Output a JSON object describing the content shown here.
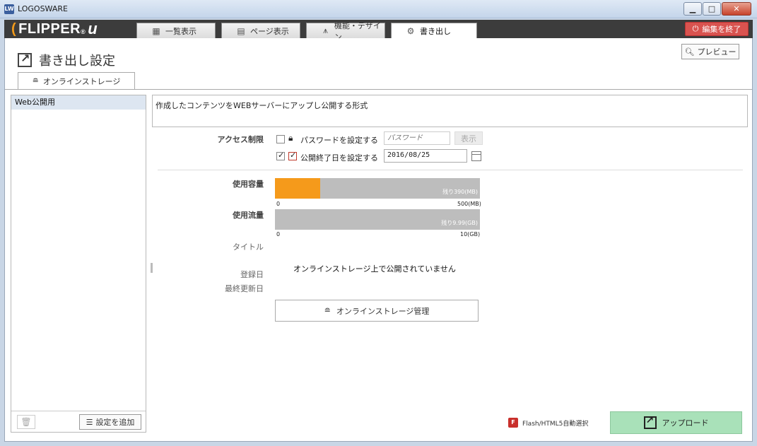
{
  "window": {
    "app_title": "LOGOSWARE",
    "app_icon_text": "LW"
  },
  "logo": {
    "brand": "FLIPPER",
    "reg": "®",
    "suffix": "u"
  },
  "tabs": [
    {
      "label": "一覧表示",
      "icon": "grid-icon"
    },
    {
      "label": "ページ表示",
      "icon": "page-icon"
    },
    {
      "label": "機能・デザイン",
      "icon": "design-icon"
    },
    {
      "label": "書き出し",
      "icon": "gear-icon",
      "active": true
    }
  ],
  "end_button": {
    "label": "編集を終了"
  },
  "page": {
    "title": "書き出し設定",
    "preview_label": "プレビュー"
  },
  "subtab": {
    "label": "オンラインストレージ"
  },
  "left": {
    "items": [
      {
        "label": "Web公開用",
        "selected": true
      }
    ],
    "add_label": "設定を追加"
  },
  "description": "作成したコンテンツをWEBサーバーにアップし公開する形式",
  "access": {
    "label": "アクセス制限",
    "password_label": "パスワードを設定する",
    "password_placeholder": "パスワード",
    "show_label": "表示",
    "password_checked": false,
    "expiry_label": "公開終了日を設定する",
    "expiry_checked": true,
    "expiry_date": "2016/08/25"
  },
  "usage": {
    "capacity_label": "使用容量",
    "capacity_remaining": "残り390(MB)",
    "capacity_min": "0",
    "capacity_max": "500(MB)",
    "capacity_used_fraction": 0.22,
    "traffic_label": "使用流量",
    "traffic_remaining": "残り9.99(GB)",
    "traffic_min": "0",
    "traffic_max": "10(GB)",
    "traffic_used_fraction": 0.0
  },
  "info": {
    "title_label": "タイトル",
    "registered_label": "登録日",
    "updated_label": "最終更新日",
    "not_published": "オンラインストレージ上で公開されていません"
  },
  "storage_manage_label": "オンラインストレージ管理",
  "flash_label": "Flash/HTML5自動選択",
  "upload_label": "アップロード",
  "colors": {
    "accent_orange": "#f59a1b",
    "upload_green": "#a9e1b9",
    "end_red": "#d9534f",
    "nav_dark": "#3c3c3c"
  }
}
